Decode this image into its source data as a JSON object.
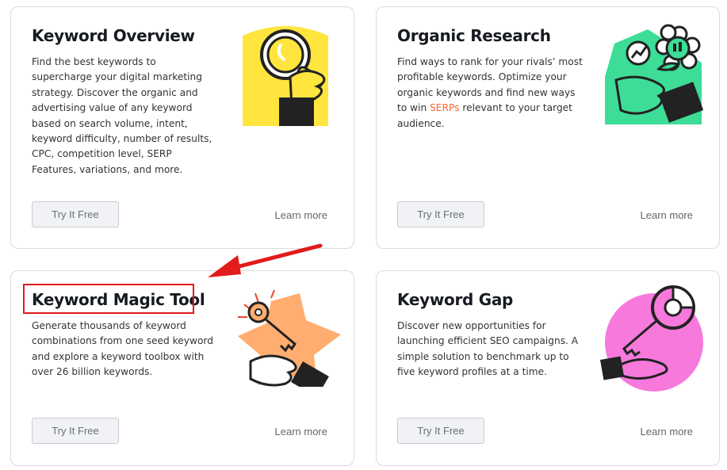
{
  "cards": [
    {
      "title": "Keyword Overview",
      "description": "Find the best keywords to supercharge your digital marketing strategy. Discover the organic and advertising value of any keyword based on search volume, intent, keyword difficulty, number of results, CPC, competition level, SERP Features, variations, and more.",
      "button": "Try It Free",
      "link": "Learn more",
      "illustration": "magnifying-glass-hand-illustration"
    },
    {
      "title": "Organic Research",
      "description_before": "Find ways to rank for your rivals’ most profitable keywords. Optimize your organic keywords and find new ways to win ",
      "description_link": "SERPs",
      "description_after": " relevant to your target audience.",
      "button": "Try It Free",
      "link": "Learn more",
      "illustration": "flower-hand-illustration"
    },
    {
      "title": "Keyword Magic Tool",
      "description": "Generate thousands of keyword combinations from one seed keyword and explore a keyword toolbox with over 26 billion keywords.",
      "button": "Try It Free",
      "link": "Learn more",
      "illustration": "key-star-hand-illustration"
    },
    {
      "title": "Keyword Gap",
      "description": "Discover new opportunities for launching efficient SEO campaigns. A simple solution to benchmark up to five keyword profiles at a time.",
      "button": "Try It Free",
      "link": "Learn more",
      "illustration": "key-pink-circle-illustration"
    }
  ],
  "colors": {
    "title": "#171a22",
    "link_accent": "#ff642d",
    "annotation_red": "#e21b1b",
    "yellow": "#ffe53d",
    "green": "#3ddc97",
    "orange": "#ffad70",
    "pink": "#f779dc"
  }
}
